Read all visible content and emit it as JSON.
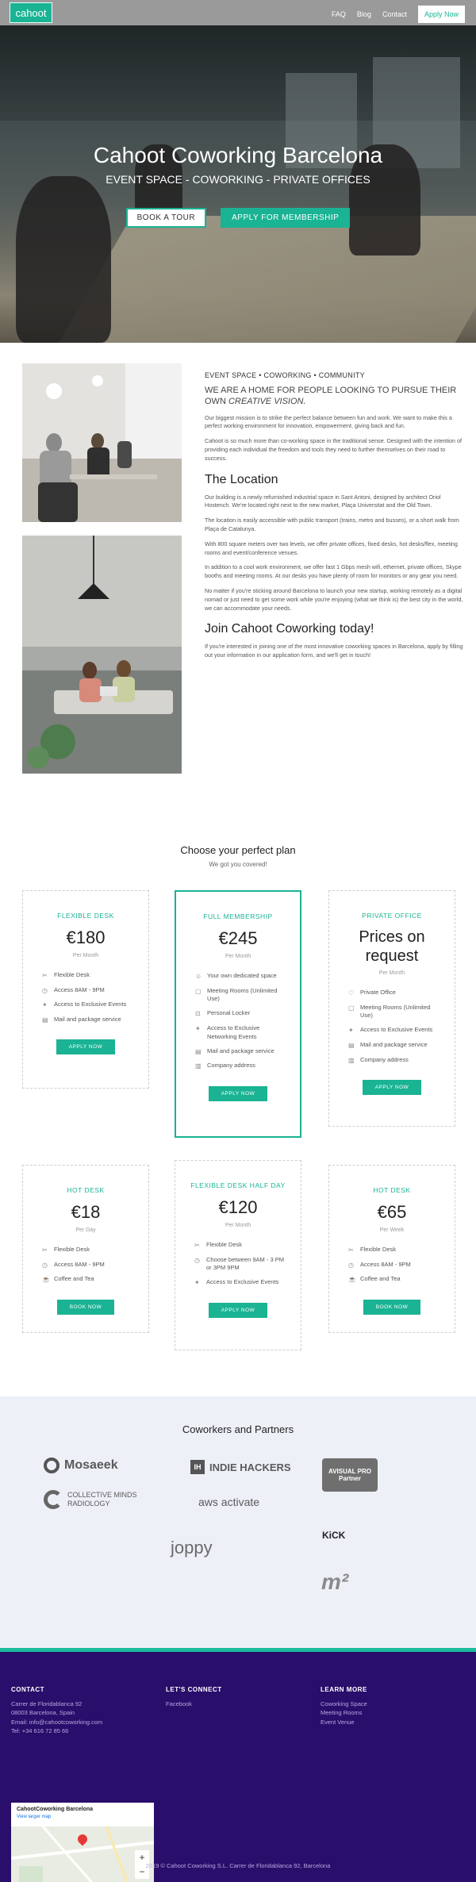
{
  "nav": {
    "logo": "cahoot",
    "links": [
      "FAQ",
      "Blog",
      "Contact"
    ],
    "apply": "Apply Now"
  },
  "hero": {
    "title": "Cahoot Coworking Barcelona",
    "subtitle": "EVENT SPACE - COWORKING - PRIVATE OFFICES",
    "btn_tour": "BOOK A TOUR",
    "btn_apply": "APPLY FOR MEMBERSHIP"
  },
  "about": {
    "kicker": "EVENT SPACE • COWORKING • COMMUNITY",
    "lead": "WE ARE A HOME FOR PEOPLE LOOKING TO PURSUE THEIR OWN",
    "lead_em": "CREATIVE VISION.",
    "p1": "Our biggest mission is to strike the perfect balance between fun and work. We want to make this a perfect working environment for innovation, empowerment, giving back and fun.",
    "p2": "Cahoot is so much more than co-working space in the traditional sense. Designed with the intention of providing each individual the freedom and tools they need to further themselves on their road to success.",
    "location_title": "The Location",
    "p3": "Our building is a newly refurnished industrial space in Sant Antoni, designed by architect Oriol Hostench. We're located right next to the new market, Plaça Universitat and the Old Town.",
    "p4": "The location is easily accessible with public transport (trains, metro and busses), or a short walk from Plaça de Catalunya.",
    "p5": "With 800 square meters over two levels, we offer private offices, fixed desks, hot desks/flex, meeting rooms and event/conference venues.",
    "p6": "In addition to a cool work environment, we offer fast 1 Gbps mesh wifi, ethernet, private offices, Skype booths and meeting rooms. At our desks you have plenty of room for monitors or any gear you need.",
    "p7": "No matter if you're sticking around Barcelona to launch your new startup, working remotely as a digital nomad or just need to get some work while you're enjoying (what we think is) the best city in the world, we can accommodate your needs.",
    "join_title": "Join Cahoot Coworking today!",
    "p8": "If you're interested in joining one of the most innovative coworking spaces in Barcelona, apply by filling out your information in our application form, and we'll get in touch!"
  },
  "plans": {
    "title": "Choose your perfect plan",
    "subtitle": "We got you covered!",
    "cards": [
      {
        "title": "FLEXIBLE DESK",
        "price": "€180",
        "per": "Per Month",
        "features": [
          "Flexible Desk",
          "Access 8AM - 9PM",
          "Access to Exclusive Events",
          "Mail and package service"
        ],
        "icons": [
          "✂",
          "◷",
          "✦",
          "▤"
        ],
        "button": "APPLY NOW"
      },
      {
        "title": "FULL MEMBERSHIP",
        "price": "€245",
        "per": "Per Month",
        "features": [
          "Your own dedicated space",
          "Meeting Rooms (Unlimited Use)",
          "Personal Locker",
          "Access to Exclusive Networking Events",
          "Mail and package service",
          "Company address"
        ],
        "icons": [
          "☺",
          "▢",
          "⊡",
          "✦",
          "▤",
          "▥"
        ],
        "button": "APPLY NOW"
      },
      {
        "title": "PRIVATE OFFICE",
        "price": "Prices on request",
        "per": "Per Month",
        "features": [
          "Private Office",
          "Meeting Rooms (Unlimited Use)",
          "Access to Exclusive Events",
          "Mail and package service",
          "Company address"
        ],
        "icons": [
          "♡",
          "▢",
          "✦",
          "▤",
          "▥"
        ],
        "button": "APPLY NOW"
      },
      {
        "title": "HOT DESK",
        "price": "€18",
        "per": "Per Day",
        "features": [
          "Flexible Desk",
          "Access 8AM - 9PM",
          "Coffee and Tea"
        ],
        "icons": [
          "✂",
          "◷",
          "☕"
        ],
        "button": "BOOK NOW"
      },
      {
        "title": "FLEXIBLE DESK HALF DAY",
        "price": "€120",
        "per": "Per Month",
        "features": [
          "Flexible Desk",
          "Choose between 9AM - 3 PM or 3PM 9PM",
          "Access to Exclusive Events"
        ],
        "icons": [
          "✂",
          "◷",
          "✦"
        ],
        "button": "APPLY NOW"
      },
      {
        "title": "HOT DESK",
        "price": "€65",
        "per": "Per Week",
        "features": [
          "Flexible Desk",
          "Access 8AM - 9PM",
          "Coffee and Tea"
        ],
        "icons": [
          "✂",
          "◷",
          "☕"
        ],
        "button": "BOOK NOW"
      }
    ]
  },
  "partners": {
    "title": "Coworkers and Partners",
    "logos": [
      "Mosaeek",
      "INDIE HACKERS",
      "AVISUAL PRO Partner",
      "COLLECTIVE MINDS RADIOLOGY",
      "aws activate",
      "joppy",
      "KiCK",
      "m²"
    ]
  },
  "footer": {
    "contact_title": "CONTACT",
    "contact_lines": [
      "Carrer de Floridablanca 92",
      "08003 Barcelona, Spain",
      "Email: info@cahootcoworking.com",
      "Tel: +34 616 72 85 66"
    ],
    "connect_title": "LET'S CONNECT",
    "connect_lines": [
      "Facebook"
    ],
    "learn_title": "LEARN MORE",
    "learn_lines": [
      "Coworking Space",
      "Meeting Rooms",
      "Event Venue"
    ],
    "map_title": "CahootCoworking Barcelona",
    "map_link": "View larger map",
    "copyright": "2019 © Cahoot Coworking S.L. Carrer de Floridablanca 92, Barcelona"
  },
  "colors": {
    "accent": "#1ab394",
    "footer_bg": "#2a0e6b",
    "partners_bg": "#eef0f8"
  }
}
